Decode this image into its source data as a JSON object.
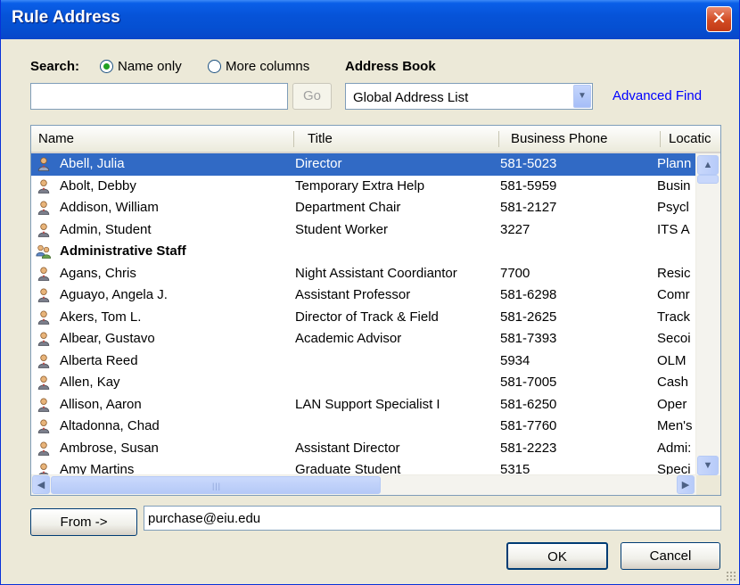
{
  "window": {
    "title": "Rule Address"
  },
  "search": {
    "label": "Search:",
    "option_name_only": "Name only",
    "option_more_columns": "More columns",
    "selected": "Name only",
    "input_value": "",
    "go_label": "Go"
  },
  "address_book": {
    "label": "Address Book",
    "selected": "Global Address List",
    "advanced_find": "Advanced Find"
  },
  "table": {
    "columns": [
      "Name",
      "Title",
      "Business Phone",
      "Locatic"
    ],
    "rows": [
      {
        "name": "Abell, Julia",
        "title": "Director",
        "phone": "581-5023",
        "location": "Plann",
        "type": "person",
        "selected": true
      },
      {
        "name": "Abolt, Debby",
        "title": "Temporary Extra Help",
        "phone": "581-5959",
        "location": "Busin",
        "type": "person"
      },
      {
        "name": "Addison, William",
        "title": "Department Chair",
        "phone": "581-2127",
        "location": "Psycl",
        "type": "person"
      },
      {
        "name": "Admin, Student",
        "title": "Student Worker",
        "phone": "3227",
        "location": "ITS A",
        "type": "person"
      },
      {
        "name": "Administrative Staff",
        "title": "",
        "phone": "",
        "location": "",
        "type": "group"
      },
      {
        "name": "Agans, Chris",
        "title": "Night Assistant Coordiantor",
        "phone": "7700",
        "location": "Resic",
        "type": "person"
      },
      {
        "name": "Aguayo, Angela J.",
        "title": "Assistant Professor",
        "phone": "581-6298",
        "location": "Comr",
        "type": "person"
      },
      {
        "name": "Akers, Tom  L.",
        "title": "Director of Track & Field",
        "phone": "581-2625",
        "location": "Track",
        "type": "person"
      },
      {
        "name": "Albear, Gustavo",
        "title": "Academic Advisor",
        "phone": "581-7393",
        "location": "Secoi",
        "type": "person"
      },
      {
        "name": "Alberta Reed",
        "title": "",
        "phone": "5934",
        "location": "OLM",
        "type": "person"
      },
      {
        "name": "Allen, Kay",
        "title": "",
        "phone": "581-7005",
        "location": "Cash",
        "type": "person"
      },
      {
        "name": "Allison, Aaron",
        "title": "LAN Support Specialist I",
        "phone": "581-6250",
        "location": "Oper",
        "type": "person"
      },
      {
        "name": "Altadonna, Chad",
        "title": "",
        "phone": "581-7760",
        "location": "Men's",
        "type": "person"
      },
      {
        "name": "Ambrose, Susan",
        "title": "Assistant Director",
        "phone": "581-2223",
        "location": "Admi:",
        "type": "person"
      },
      {
        "name": "Amy Martins",
        "title": "Graduate Student",
        "phone": "5315",
        "location": "Speci",
        "type": "person"
      }
    ]
  },
  "from": {
    "button_label": "From ->",
    "value": "purchase@eiu.edu"
  },
  "buttons": {
    "ok": "OK",
    "cancel": "Cancel"
  },
  "icons": {
    "person": "person-icon",
    "group": "group-icon",
    "selected_radio_color": "#21a121",
    "selection_color": "#316ac5"
  }
}
